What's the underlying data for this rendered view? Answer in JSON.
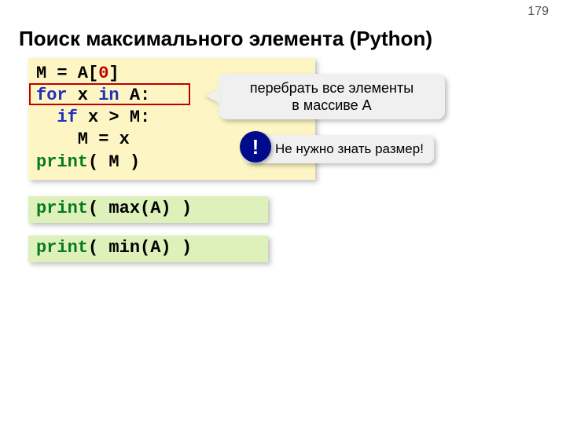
{
  "page_number": "179",
  "title": "Поиск максимального элемента (Python)",
  "code": {
    "l1a": "M = A[",
    "l1b": "0",
    "l1c": "]",
    "l2a": "for",
    "l2b": " x ",
    "l2c": "in",
    "l2d": " A:",
    "l3a": "  ",
    "l3b": "if",
    "l3c": " x > M:",
    "l4": "    M = x",
    "l5a": "print",
    "l5b": "( M )"
  },
  "callout1_line1": "перебрать все элементы",
  "callout1_line2": "в массиве A",
  "badge": "!",
  "callout2": "Не нужно знать размер!",
  "short_max": {
    "a": "print",
    "b": "( max(A) )"
  },
  "short_min": {
    "a": "print",
    "b": "( min(A) )"
  }
}
